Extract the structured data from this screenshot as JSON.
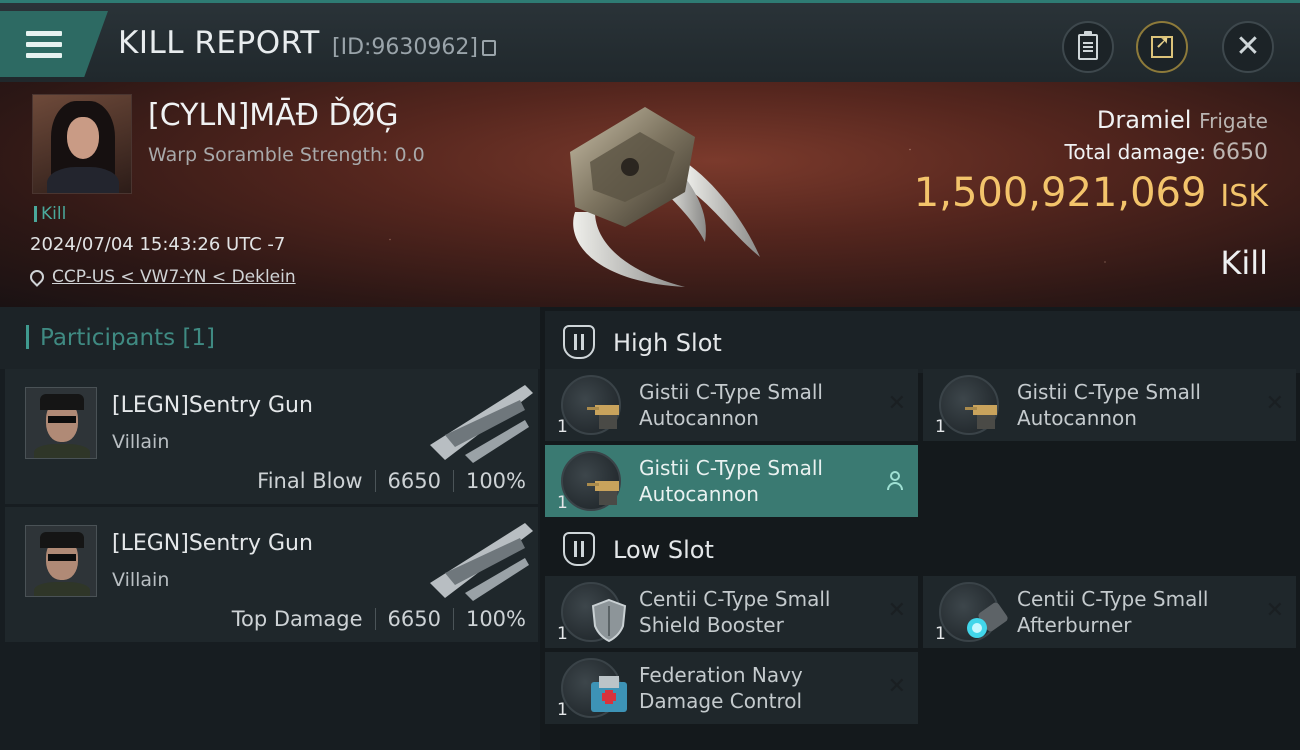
{
  "header": {
    "title": "KILL REPORT",
    "kill_id": "[ID:9630962]"
  },
  "victim": {
    "name": "[CYLN]MĀĐ ĎØĢ",
    "scramble": "Warp Soramble Strength: 0.0",
    "tag": "Kill",
    "datetime": "2024/07/04 15:43:26 UTC -7",
    "location": "CCP-US < VW7-YN < Deklein"
  },
  "ship": {
    "name": "Dramiel",
    "class": "Frigate",
    "total_damage_label": "Total damage:",
    "total_damage": "6650",
    "isk_value": "1,500,921,069",
    "isk_unit": "ISK",
    "result": "Kill"
  },
  "participants": {
    "label": "Participants",
    "count": "[1]",
    "items": [
      {
        "name": "[LEGN]Sentry Gun",
        "role": "Villain",
        "stat_label": "Final Blow",
        "damage": "6650",
        "percent": "100%"
      },
      {
        "name": "[LEGN]Sentry Gun",
        "role": "Villain",
        "stat_label": "Top Damage",
        "damage": "6650",
        "percent": "100%"
      }
    ]
  },
  "slots": {
    "high_title": "High Slot",
    "low_title": "Low Slot",
    "high": [
      {
        "qty": "1",
        "name": "Gistii C-Type Small Autocannon"
      },
      {
        "qty": "1",
        "name": "Gistii C-Type Small Autocannon"
      },
      {
        "qty": "1",
        "name": "Gistii C-Type Small Autocannon"
      }
    ],
    "low": [
      {
        "qty": "1",
        "name": "Centii C-Type Small Shield Booster"
      },
      {
        "qty": "1",
        "name": "Centii C-Type Small Afterburner"
      },
      {
        "qty": "1",
        "name": "Federation Navy Damage Control"
      }
    ],
    "close_glyph": "✕"
  },
  "icons": {
    "menu": "menu-icon",
    "clipboard": "clipboard-icon",
    "export": "export-icon",
    "close": "close-icon",
    "pin": "location-pin-icon",
    "slot": "slot-shield-icon",
    "person": "person-icon"
  },
  "colors": {
    "accent": "#2e7b73",
    "isk": "#f3c46b",
    "active_module": "#3a7a72"
  }
}
